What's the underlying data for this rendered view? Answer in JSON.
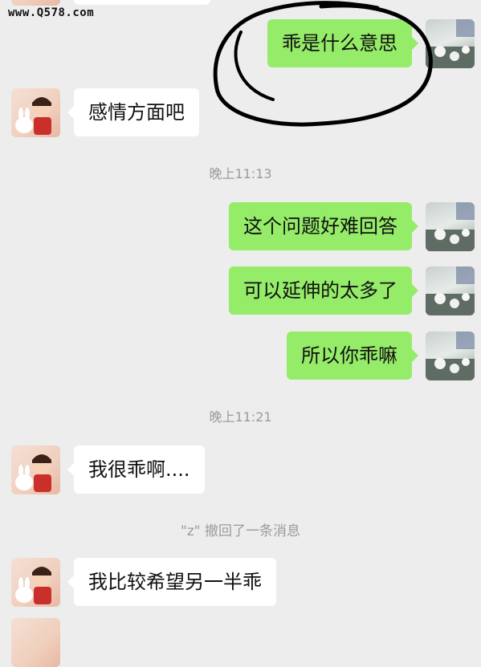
{
  "watermark": "www.Q578.com",
  "messages": [
    {
      "side": "right",
      "text": "乖是什么意思"
    },
    {
      "side": "left",
      "text": "感情方面吧"
    },
    {
      "side": "right",
      "text": "这个问题好难回答"
    },
    {
      "side": "right",
      "text": "可以延伸的太多了"
    },
    {
      "side": "right",
      "text": "所以你乖嘛"
    },
    {
      "side": "left",
      "text": "我很乖啊...."
    },
    {
      "side": "left",
      "text": "我比较希望另一半乖"
    }
  ],
  "timestamps": [
    "晚上11:13",
    "晚上11:21"
  ],
  "system_notice": "\"z\" 撤回了一条消息",
  "colors": {
    "background": "#ededed",
    "self_bubble": "#95ec69",
    "friend_bubble": "#ffffff",
    "meta_text": "#9b9b9b",
    "annotation_ink": "#000000"
  },
  "icons": {
    "friend_avatar": "cartoon-boy-with-rabbit-avatar",
    "self_avatar": "flower-photo-avatar"
  }
}
